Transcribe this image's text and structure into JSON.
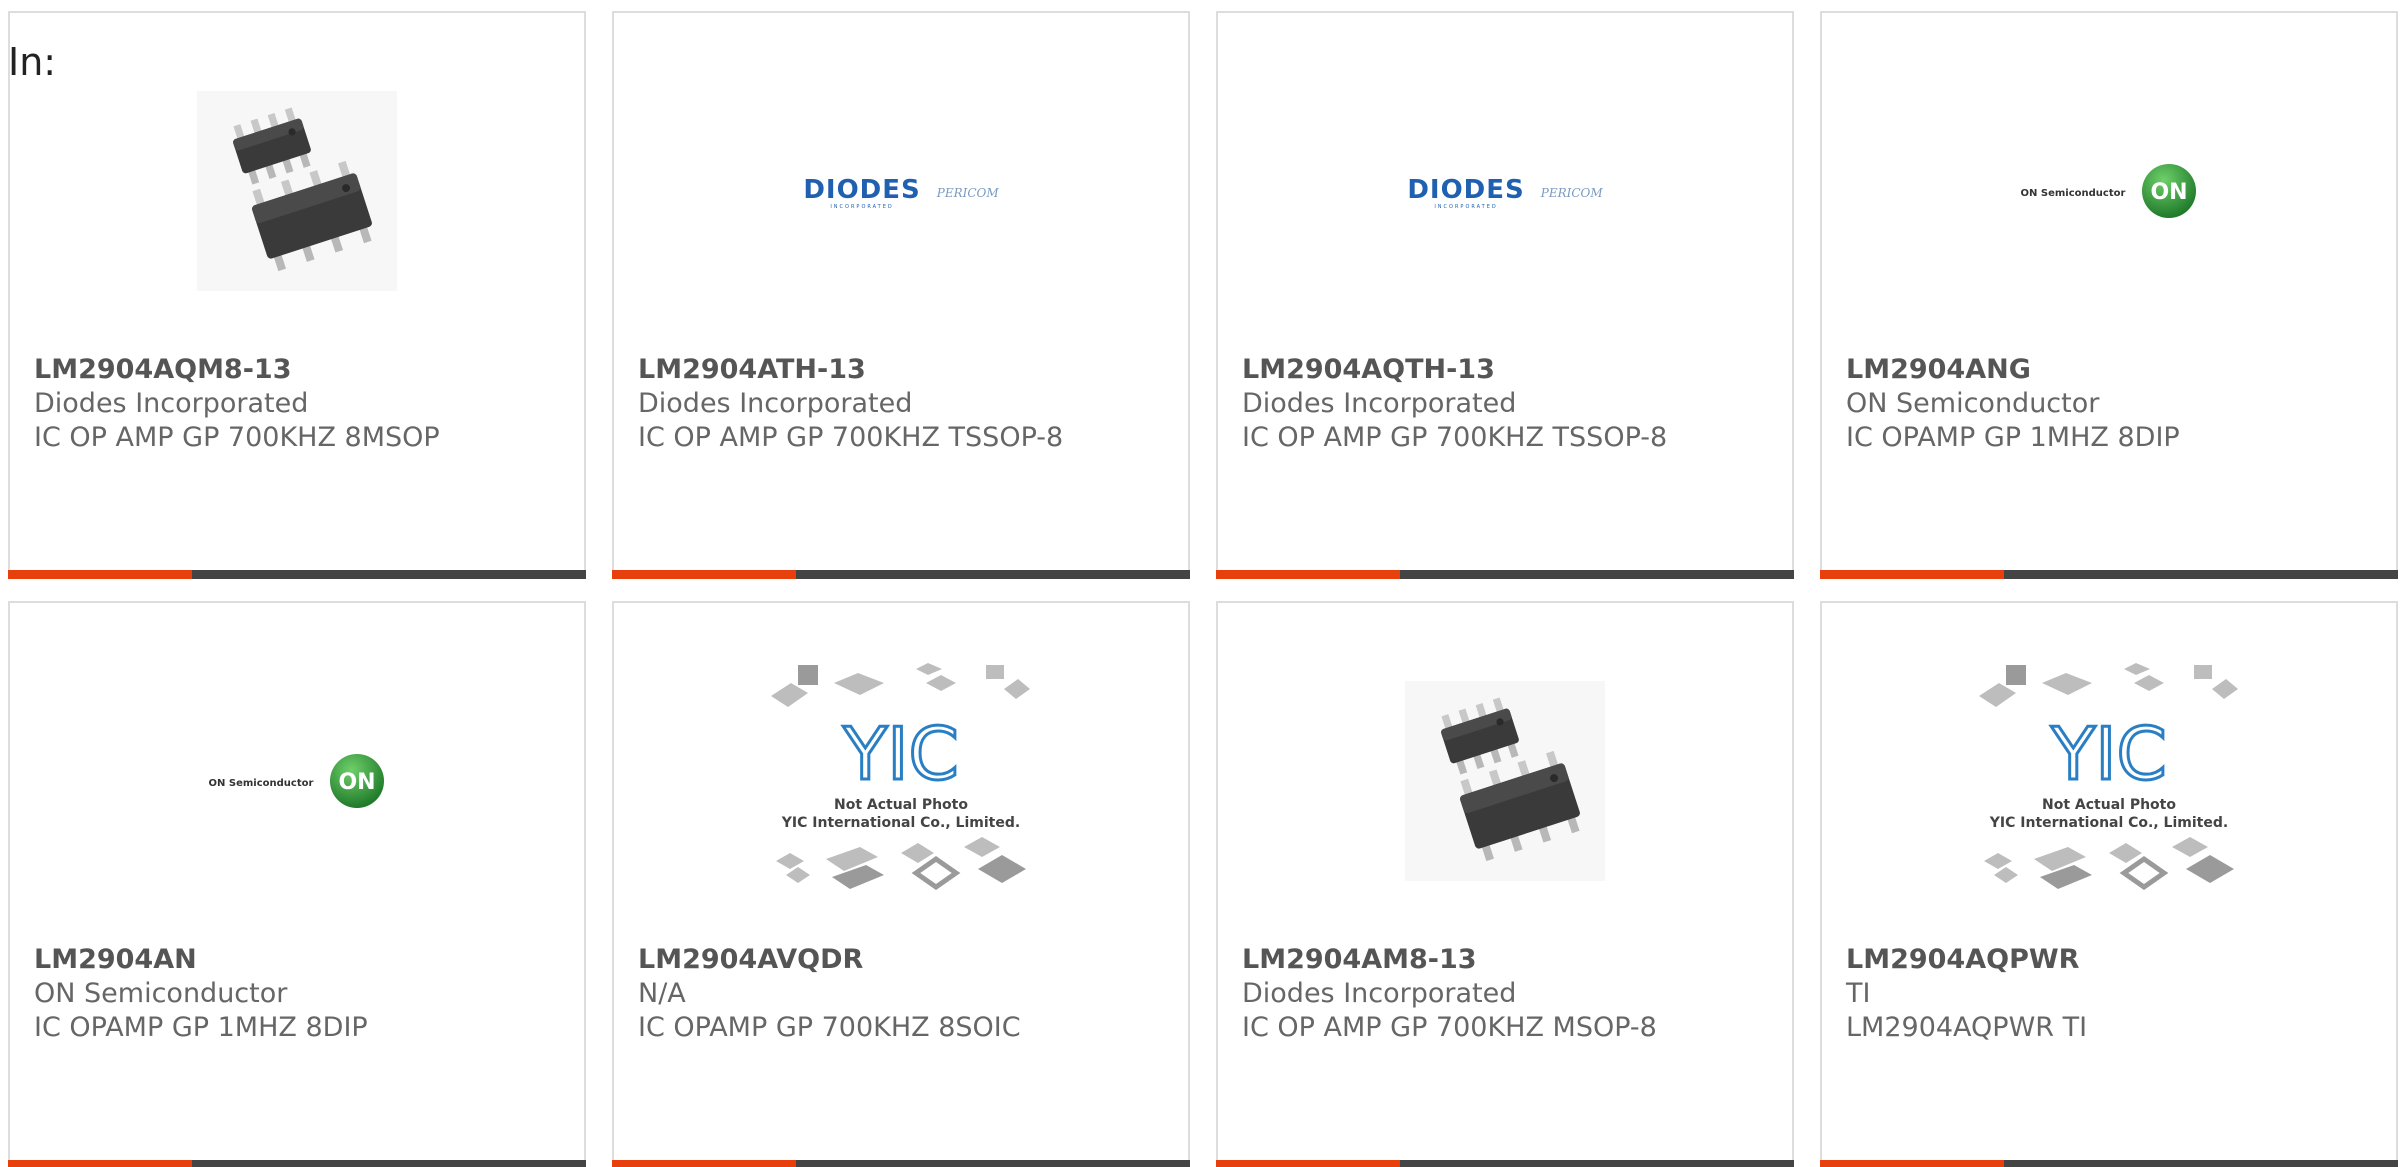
{
  "header": {
    "in_label": "In:"
  },
  "colors": {
    "accent": "#e8400c",
    "bar_dark": "#444444"
  },
  "products": [
    {
      "part_number": "LM2904AQM8-13",
      "manufacturer": "Diodes Incorporated",
      "description": "IC OP AMP GP 700KHZ 8MSOP",
      "image": "msop-chip-photo"
    },
    {
      "part_number": "LM2904ATH-13",
      "manufacturer": "Diodes Incorporated",
      "description": "IC OP AMP GP 700KHZ TSSOP-8",
      "image": "diodes-pericom-logo"
    },
    {
      "part_number": "LM2904AQTH-13",
      "manufacturer": "Diodes Incorporated",
      "description": "IC OP AMP GP 700KHZ TSSOP-8",
      "image": "diodes-pericom-logo"
    },
    {
      "part_number": "LM2904ANG",
      "manufacturer": "ON Semiconductor",
      "description": "IC OPAMP GP 1MHZ 8DIP",
      "image": "on-semiconductor-logo"
    },
    {
      "part_number": "LM2904AN",
      "manufacturer": "ON Semiconductor",
      "description": "IC OPAMP GP 1MHZ 8DIP",
      "image": "on-semiconductor-logo"
    },
    {
      "part_number": "LM2904AVQDR",
      "manufacturer": "N/A",
      "description": "IC OPAMP GP 700KHZ 8SOIC",
      "image": "yic-placeholder"
    },
    {
      "part_number": "LM2904AM8-13",
      "manufacturer": "Diodes Incorporated",
      "description": "IC OP AMP GP 700KHZ MSOP-8",
      "image": "msop-chip-photo"
    },
    {
      "part_number": "LM2904AQPWR",
      "manufacturer": "TI",
      "description": "LM2904AQPWR TI",
      "image": "yic-placeholder"
    }
  ],
  "logos": {
    "diodes": {
      "name": "DIODES",
      "sub": "INCORPORATED",
      "pericom": "PERICOM"
    },
    "on": {
      "name": "ON Semiconductor",
      "badge": "ON"
    },
    "yic": {
      "line1": "Not Actual Photo",
      "line2": "YIC International Co., Limited."
    }
  }
}
